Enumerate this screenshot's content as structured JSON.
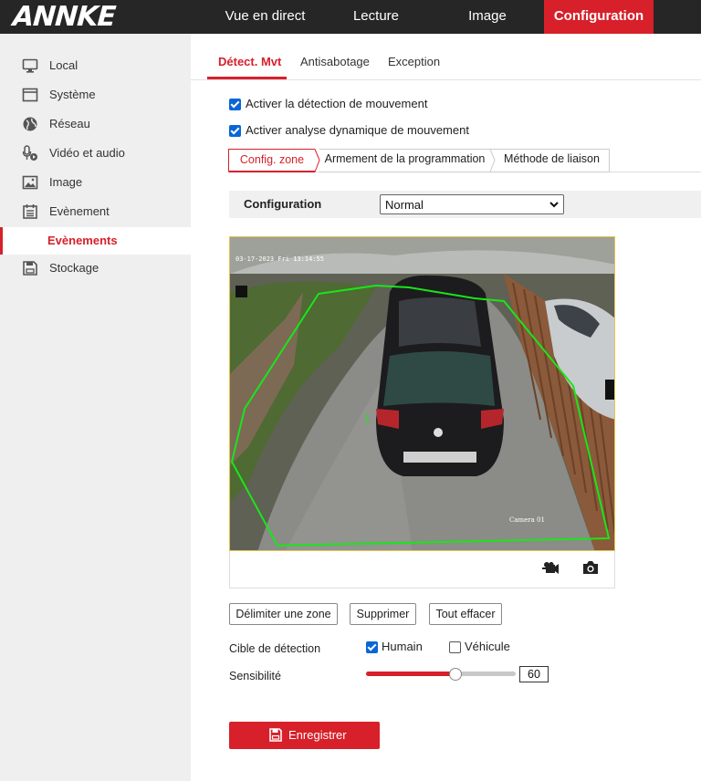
{
  "brand": {
    "logo": "ANNKE"
  },
  "topnav": [
    {
      "label": "Vue en direct",
      "active": false
    },
    {
      "label": "Lecture",
      "active": false
    },
    {
      "label": "Image",
      "active": false
    },
    {
      "label": "Configuration",
      "active": true
    }
  ],
  "sidebar": {
    "items": [
      {
        "label": "Local",
        "icon": "monitor-icon"
      },
      {
        "label": "Système",
        "icon": "system-icon"
      },
      {
        "label": "Réseau",
        "icon": "globe-icon"
      },
      {
        "label": "Vidéo et audio",
        "icon": "mic-camera-icon"
      },
      {
        "label": "Image",
        "icon": "image-icon"
      },
      {
        "label": "Evènement",
        "icon": "calendar-icon"
      }
    ],
    "sub_active": "Evènements",
    "storage": {
      "label": "Stockage",
      "icon": "storage-icon"
    }
  },
  "tabs": [
    {
      "label": "Détect. Mvt",
      "active": true
    },
    {
      "label": "Antisabotage",
      "active": false
    },
    {
      "label": "Exception",
      "active": false
    }
  ],
  "options": {
    "motion_detection": {
      "label": "Activer la détection de mouvement",
      "checked": true
    },
    "dynamic_analysis": {
      "label": "Activer analyse dynamique de mouvement",
      "checked": true
    }
  },
  "steps": [
    {
      "label": "Config. zone",
      "active": true
    },
    {
      "label": "Armement de la programmation",
      "active": false
    },
    {
      "label": "Méthode de liaison",
      "active": false
    }
  ],
  "configuration": {
    "label": "Configuration",
    "value": "Normal"
  },
  "video": {
    "timestamp": "03-17-2023 Fri 13:14:55",
    "camera_name": "Camera 01",
    "zone_number": "1",
    "zone_color": "#19e619"
  },
  "buttons": {
    "draw_zone": "Délimiter une zone",
    "delete": "Supprimer",
    "clear_all": "Tout effacer"
  },
  "detection_target": {
    "label": "Cible de détection",
    "human": {
      "label": "Humain",
      "checked": true
    },
    "vehicle": {
      "label": "Véhicule",
      "checked": false
    }
  },
  "sensitivity": {
    "label": "Sensibilité",
    "value": 60
  },
  "save": {
    "label": "Enregistrer"
  },
  "colors": {
    "accent": "#d7202a",
    "topbar": "#262626",
    "checkbox": "#0a66d6"
  }
}
